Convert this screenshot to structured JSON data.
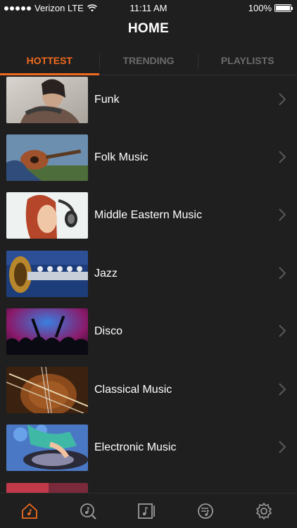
{
  "status_bar": {
    "carrier": "Verizon LTE",
    "time": "11:11 AM",
    "battery": "100%"
  },
  "header": {
    "title": "HOME"
  },
  "tabs": [
    {
      "label": "HOTTEST",
      "active": true
    },
    {
      "label": "TRENDING",
      "active": false
    },
    {
      "label": "PLAYLISTS",
      "active": false
    }
  ],
  "genres": [
    {
      "label": "Funk"
    },
    {
      "label": "Folk Music"
    },
    {
      "label": "Middle Eastern Music"
    },
    {
      "label": "Jazz"
    },
    {
      "label": "Disco"
    },
    {
      "label": "Classical Music"
    },
    {
      "label": "Electronic Music"
    }
  ],
  "bottom_nav": [
    {
      "icon": "home-icon",
      "active": true
    },
    {
      "icon": "music-search-icon",
      "active": false
    },
    {
      "icon": "music-library-icon",
      "active": false
    },
    {
      "icon": "playlist-icon",
      "active": false
    },
    {
      "icon": "settings-gear-icon",
      "active": false
    }
  ],
  "colors": {
    "accent": "#f06a1e",
    "background": "#1f1f1f",
    "tab_inactive": "#6b6b6b"
  }
}
